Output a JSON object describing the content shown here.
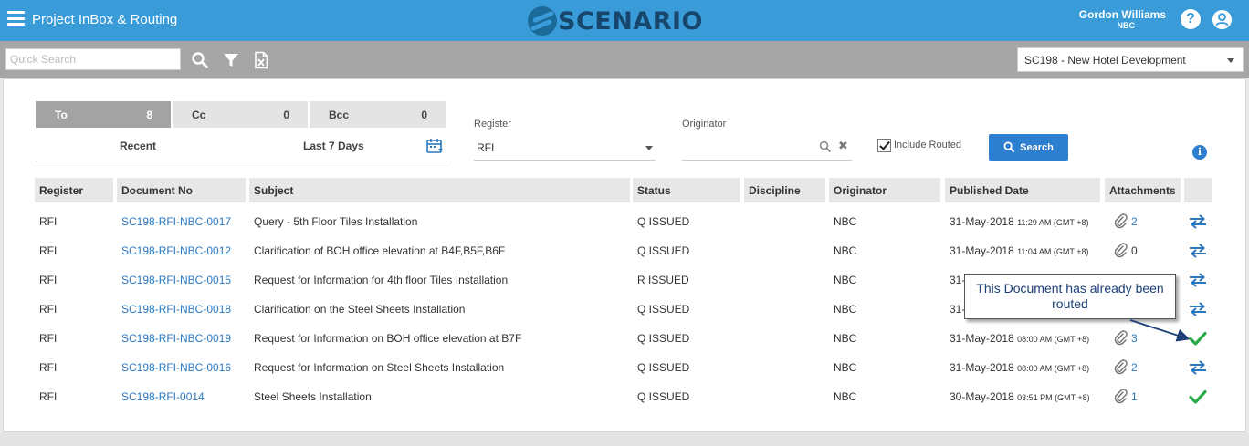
{
  "header": {
    "app_title": "Project InBox & Routing",
    "logo_text": "SCENARIO",
    "user_name": "Gordon Williams",
    "user_org": "NBC",
    "help_glyph": "?",
    "brand_color": "#3a9bd9"
  },
  "toolbar": {
    "search_placeholder": "Quick Search",
    "project": "SC198 - New Hotel Development"
  },
  "tabs": [
    {
      "label": "To",
      "count": "8"
    },
    {
      "label": "Cc",
      "count": "0"
    },
    {
      "label": "Bcc",
      "count": "0"
    }
  ],
  "time_filters": {
    "recent": "Recent",
    "last7": "Last 7 Days"
  },
  "filters": {
    "register_label": "Register",
    "register_value": "RFI",
    "originator_label": "Originator",
    "originator_value": "",
    "include_routed_label": "Include Routed",
    "include_routed_checked": true,
    "search_button": "Search",
    "info_glyph": "i"
  },
  "table": {
    "headers": {
      "register": "Register",
      "document_no": "Document No",
      "subject": "Subject",
      "status": "Status",
      "discipline": "Discipline",
      "originator": "Originator",
      "published_date": "Published Date",
      "attachments": "Attachments"
    },
    "rows": [
      {
        "register": "RFI",
        "doc": "SC198-RFI-NBC-0017",
        "subject": "Query - 5th Floor Tiles Installation",
        "status": "Q ISSUED",
        "originator": "NBC",
        "date": "31-May-2018",
        "time": "11:29 AM (GMT +8)",
        "att": "2",
        "routed": false
      },
      {
        "register": "RFI",
        "doc": "SC198-RFI-NBC-0012",
        "subject": "Clarification of BOH office elevation at B4F,B5F,B6F",
        "status": "Q ISSUED",
        "originator": "NBC",
        "date": "31-May-2018",
        "time": "11:04 AM (GMT +8)",
        "att": "0",
        "routed": false
      },
      {
        "register": "RFI",
        "doc": "SC198-RFI-NBC-0015",
        "subject": "Request for Information for 4th floor Tiles Installation",
        "status": "R ISSUED",
        "originator": "NBC",
        "date": "31-",
        "time": "",
        "att": "",
        "routed": false
      },
      {
        "register": "RFI",
        "doc": "SC198-RFI-NBC-0018",
        "subject": "Clarification on the Steel Sheets Installation",
        "status": "Q ISSUED",
        "originator": "NBC",
        "date": "31-",
        "time": "",
        "att": "",
        "routed": false
      },
      {
        "register": "RFI",
        "doc": "SC198-RFI-NBC-0019",
        "subject": "Request for Information on BOH office elevation at B7F",
        "status": "Q ISSUED",
        "originator": "NBC",
        "date": "31-May-2018",
        "time": "08:00 AM (GMT +8)",
        "att": "3",
        "routed": true
      },
      {
        "register": "RFI",
        "doc": "SC198-RFI-NBC-0016",
        "subject": "Request for Information on Steel Sheets Installation",
        "status": "Q ISSUED",
        "originator": "NBC",
        "date": "31-May-2018",
        "time": "08:00 AM (GMT +8)",
        "att": "2",
        "routed": false
      },
      {
        "register": "RFI",
        "doc": "SC198-RFI-0014",
        "subject": "Steel Sheets Installation",
        "status": "Q ISSUED",
        "originator": "NBC",
        "date": "30-May-2018",
        "time": "03:51 PM (GMT +8)",
        "att": "1",
        "routed": true
      }
    ]
  },
  "callout": {
    "text": "This Document has already been routed"
  },
  "colors": {
    "link": "#2b78bf",
    "check": "#2bab4a",
    "route": "#2b78bf"
  }
}
